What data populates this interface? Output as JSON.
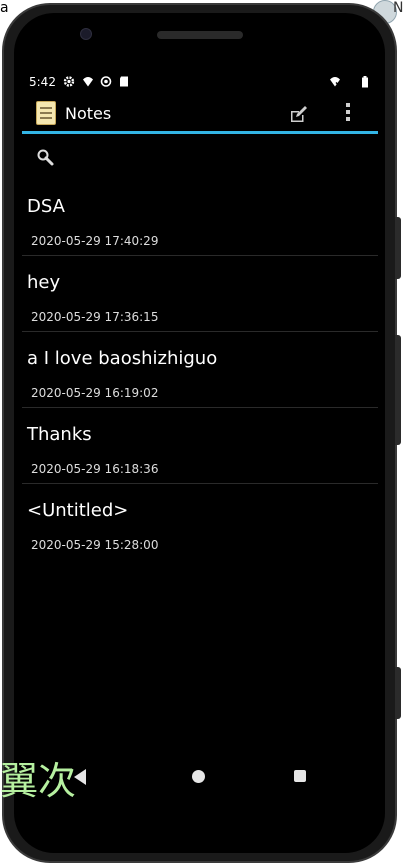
{
  "edge": {
    "left_text": "a",
    "right_text": "N"
  },
  "status_bar": {
    "time": "5:42"
  },
  "app_bar": {
    "title": "Notes"
  },
  "notes": [
    {
      "title": "DSA",
      "date": "2020-05-29 17:40:29"
    },
    {
      "title": "hey",
      "date": "2020-05-29 17:36:15"
    },
    {
      "title": "a I love baoshizhiguo",
      "date": "2020-05-29 16:19:02"
    },
    {
      "title": "Thanks",
      "date": "2020-05-29 16:18:36"
    },
    {
      "title": "<Untitled>",
      "date": "2020-05-29 15:28:00"
    }
  ],
  "overlay": {
    "text": "翼次"
  },
  "colors": {
    "accent": "#33b5e5",
    "background": "#000000",
    "overlay_text": "#b6f0a0"
  },
  "icons": [
    "settings-gear-icon",
    "wifi-icon",
    "sync-icon",
    "sd-card-icon",
    "no-signal-icon",
    "battery-icon",
    "notepad-app-icon",
    "compose-note-icon",
    "overflow-menu-icon",
    "search-icon",
    "nav-back-icon",
    "nav-home-icon",
    "nav-recents-icon"
  ]
}
